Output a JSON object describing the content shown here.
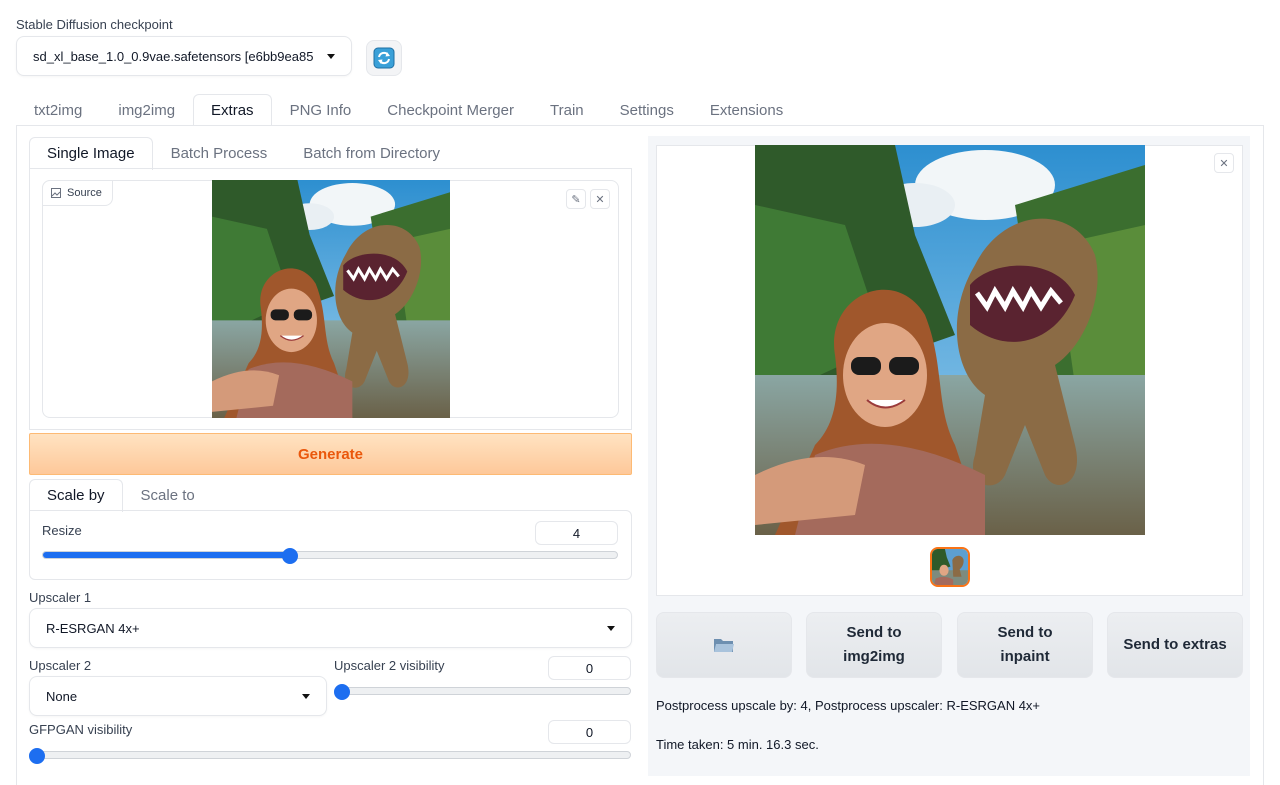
{
  "checkpoint": {
    "label": "Stable Diffusion checkpoint",
    "value": "sd_xl_base_1.0_0.9vae.safetensors [e6bb9ea85",
    "refresh_icon": "refresh-icon"
  },
  "main_tabs": [
    "txt2img",
    "img2img",
    "Extras",
    "PNG Info",
    "Checkpoint Merger",
    "Train",
    "Settings",
    "Extensions"
  ],
  "main_tab_active": "Extras",
  "extras": {
    "sub_tabs": [
      "Single Image",
      "Batch Process",
      "Batch from Directory"
    ],
    "sub_tab_active": "Single Image",
    "source_label": "Source",
    "generate_label": "Generate",
    "scale_tabs": [
      "Scale by",
      "Scale to"
    ],
    "scale_tab_active": "Scale by",
    "resize": {
      "label": "Resize",
      "value": "4",
      "fraction": 0.41
    },
    "upscaler1": {
      "label": "Upscaler 1",
      "value": "R-ESRGAN 4x+"
    },
    "upscaler2": {
      "label": "Upscaler 2",
      "value": "None"
    },
    "upscaler2_visibility": {
      "label": "Upscaler 2 visibility",
      "value": "0",
      "fraction": 0
    },
    "gfpgan_visibility": {
      "label": "GFPGAN visibility",
      "value": "0",
      "fraction": 0
    }
  },
  "output": {
    "buttons": {
      "folder_icon": "folder-icon",
      "send_img2img": "Send to img2img",
      "send_inpaint": "Send to inpaint",
      "send_extras": "Send to extras"
    },
    "info_line": "Postprocess upscale by: 4, Postprocess upscaler: R-ESRGAN 4x+",
    "time_taken": "Time taken: 5 min. 16.3 sec."
  },
  "colors": {
    "accent": "#1d6ef0",
    "generate_text": "#ea580c",
    "thumb_border": "#f97316"
  }
}
